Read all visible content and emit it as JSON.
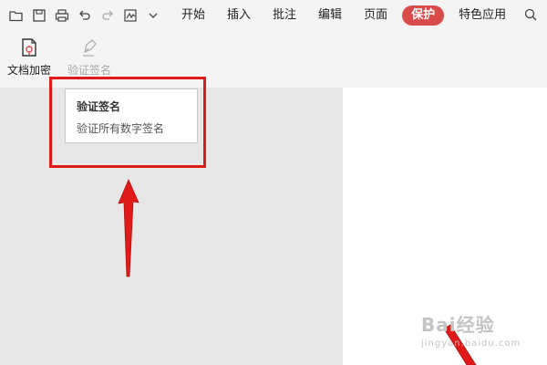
{
  "toolbar": {
    "menu": [
      "开始",
      "插入",
      "批注",
      "编辑",
      "页面",
      "保护",
      "特色应用"
    ],
    "active_menu": "保护",
    "accent_color": "#d94a4a"
  },
  "ribbon": {
    "encrypt_label": "文档加密",
    "verify_label": "验证签名"
  },
  "tooltip": {
    "title": "验证签名",
    "description": "验证所有数字签名"
  },
  "annotation": {
    "box_color": "#e01919",
    "arrow_color": "#e01919"
  },
  "watermark": {
    "main": "Bai经验",
    "sub": "jingyan.baidu.com"
  }
}
